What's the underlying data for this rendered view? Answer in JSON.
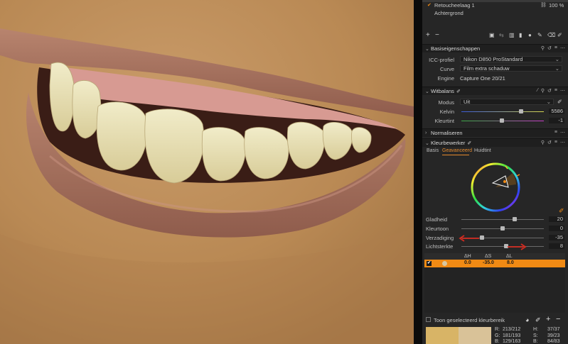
{
  "layers": {
    "retouch_layer": "Retoucheelaag 1",
    "opacity": "100 %",
    "background_layer": "Achtergrond"
  },
  "basic": {
    "title": "Basiseigenschappen",
    "icc_label": "ICC-profiel",
    "icc_value": "Nikon D850 ProStandard",
    "curve_label": "Curve",
    "curve_value": "Film extra schaduw",
    "engine_label": "Engine",
    "engine_value": "Capture One 20/21"
  },
  "whitebalance": {
    "title": "Witbalans",
    "mode_label": "Modus",
    "mode_value": "Uit",
    "kelvin_label": "Kelvin",
    "kelvin_value": "5586",
    "kelvin_pos": 0.72,
    "tint_label": "Kleurtint",
    "tint_value": "-1",
    "tint_pos": 0.49
  },
  "normalize": {
    "title": "Normaliseren"
  },
  "coloreditor": {
    "title": "Kleurbewerker",
    "tabs": [
      "Basis",
      "Geavanceerd",
      "Huidtint"
    ],
    "active_tab": 1,
    "sliders": [
      {
        "label": "Gladheid",
        "value": "20",
        "pos": 0.65
      },
      {
        "label": "Kleurtoon",
        "value": "0",
        "pos": 0.5
      },
      {
        "label": "Verzadiging",
        "value": "-35",
        "pos": 0.25
      },
      {
        "label": "Lichtsterkte",
        "value": "8",
        "pos": 0.54
      }
    ],
    "table_headers": [
      "ΔH",
      "ΔS",
      "ΔL"
    ],
    "table_row": [
      "0.0",
      "-35.0",
      "8.0"
    ],
    "show_selected": "Toon geselecteerd kleurbereik",
    "readout": {
      "r": "R:",
      "r_val": "213/212",
      "g": "G:",
      "g_val": "181/193",
      "b": "B:",
      "b_val": "129/163",
      "h": "H:",
      "h_val": "37/37",
      "s": "S:",
      "s_val": "39/23",
      "b2": "B:",
      "b2_val": "84/83"
    },
    "swatch_before": "#d8b466",
    "swatch_after": "#d9c298"
  },
  "colors": {
    "accent": "#f08a14",
    "annotation_arrow": "#d42a1f"
  }
}
